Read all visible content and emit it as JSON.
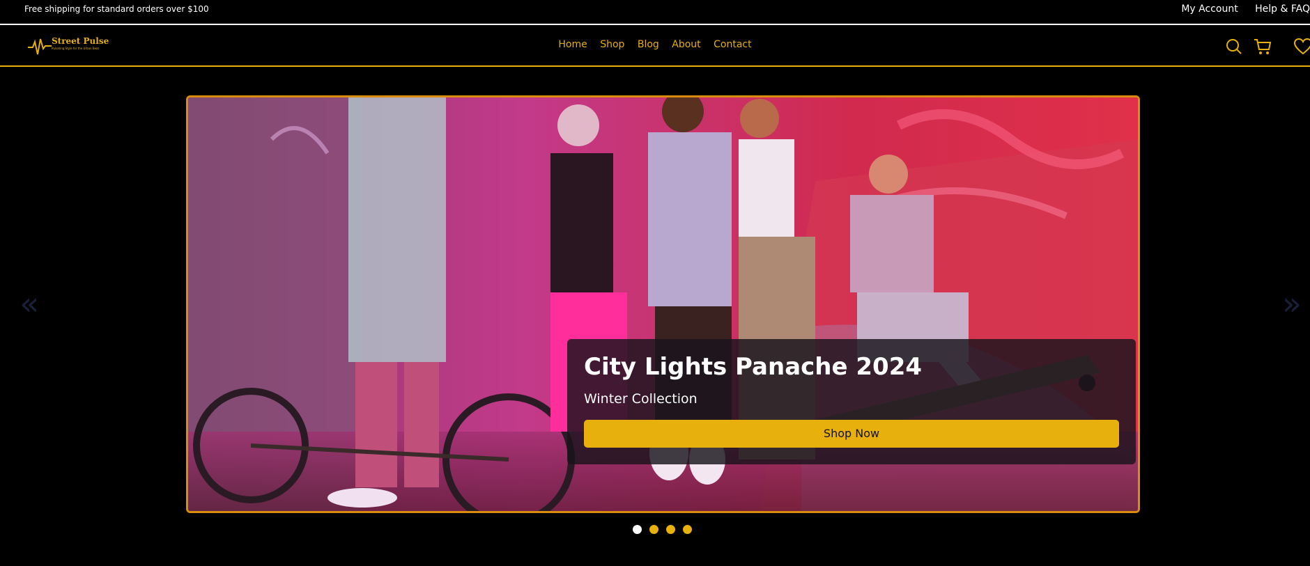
{
  "topbar": {
    "shipping_text": "Free shipping for standard orders over $100",
    "links": [
      "My Account",
      "Help & FAQ"
    ]
  },
  "brand": {
    "name": "Street Pulse",
    "tagline": "Pulsating Style for the Urban Beat"
  },
  "nav": {
    "items": [
      "Home",
      "Shop",
      "Blog",
      "About",
      "Contact"
    ],
    "icons": [
      "search-icon",
      "cart-icon",
      "heart-icon"
    ]
  },
  "hero": {
    "title": "City Lights Panache 2024",
    "subtitle": "Winter Collection",
    "cta": "Shop Now",
    "prev_arrow": "«",
    "next_arrow": "»",
    "slide_count": 4,
    "active_slide": 1
  },
  "colors": {
    "background": "#000000",
    "accent": "#e8b00c",
    "hero_border": "#d98c0e",
    "arrow": "#1a2038",
    "dot_active": "#ffffff",
    "dot_inactive": "#e8b00c"
  }
}
